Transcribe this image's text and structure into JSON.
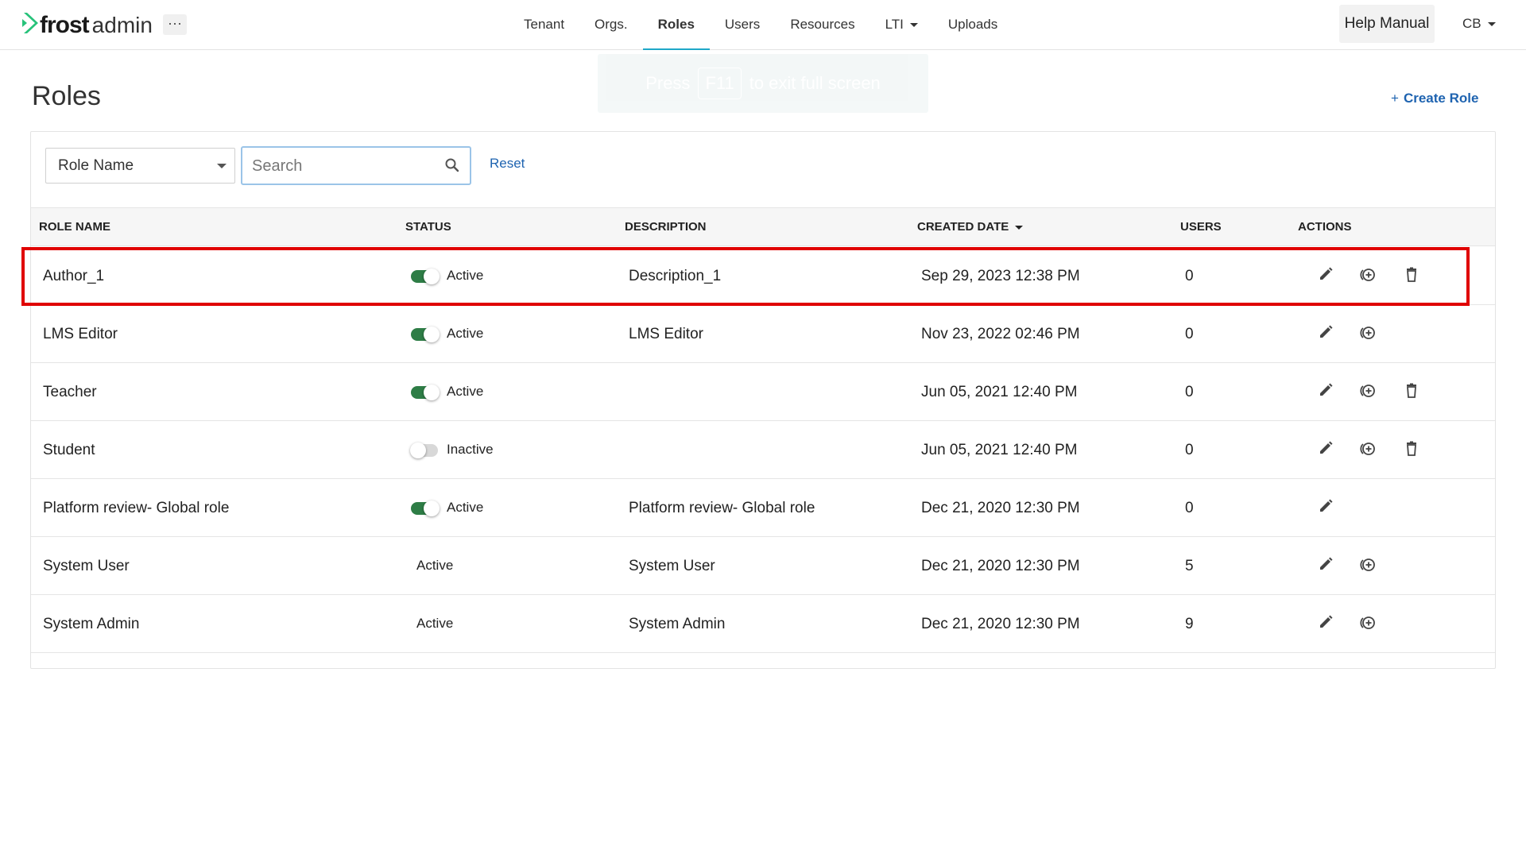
{
  "app": {
    "logo_frost": "frost",
    "logo_admin": "admin",
    "more_label": "···"
  },
  "nav": {
    "items": [
      {
        "label": "Tenant"
      },
      {
        "label": "Orgs."
      },
      {
        "label": "Roles"
      },
      {
        "label": "Users"
      },
      {
        "label": "Resources"
      },
      {
        "label": "LTI"
      },
      {
        "label": "Uploads"
      }
    ],
    "active": "Roles",
    "help_label": "Help Manual",
    "user_initials": "CB"
  },
  "fullscreen_toast": {
    "prefix": "Press",
    "key": "F11",
    "suffix": "to exit full screen"
  },
  "page": {
    "title": "Roles",
    "create_label": "Create Role",
    "create_plus": "+"
  },
  "filters": {
    "field_value": "Role Name",
    "search_placeholder": "Search",
    "search_value": "",
    "reset_label": "Reset"
  },
  "table": {
    "columns": {
      "role_name": "ROLE NAME",
      "status": "STATUS",
      "description": "DESCRIPTION",
      "created_date": "CREATED DATE",
      "users": "USERS",
      "actions": "ACTIONS"
    },
    "rows": [
      {
        "role": "Author_1",
        "status": "Active",
        "toggle": "on",
        "description": "Description_1",
        "created": "Sep 29, 2023 12:38 PM",
        "users": "0",
        "actions": [
          "edit",
          "copy",
          "delete"
        ]
      },
      {
        "role": "LMS Editor",
        "status": "Active",
        "toggle": "on",
        "description": "LMS Editor",
        "created": "Nov 23, 2022 02:46 PM",
        "users": "0",
        "actions": [
          "edit",
          "copy"
        ]
      },
      {
        "role": "Teacher",
        "status": "Active",
        "toggle": "on",
        "description": "",
        "created": "Jun 05, 2021 12:40 PM",
        "users": "0",
        "actions": [
          "edit",
          "copy",
          "delete"
        ]
      },
      {
        "role": "Student",
        "status": "Inactive",
        "toggle": "off",
        "description": "",
        "created": "Jun 05, 2021 12:40 PM",
        "users": "0",
        "actions": [
          "edit",
          "copy",
          "delete"
        ]
      },
      {
        "role": "Platform review- Global role",
        "status": "Active",
        "toggle": "on",
        "description": "Platform review- Global role",
        "created": "Dec 21, 2020 12:30 PM",
        "users": "0",
        "actions": [
          "edit"
        ]
      },
      {
        "role": "System User",
        "status": "Active",
        "toggle": "none",
        "description": "System User",
        "created": "Dec 21, 2020 12:30 PM",
        "users": "5",
        "actions": [
          "edit",
          "copy"
        ]
      },
      {
        "role": "System Admin",
        "status": "Active",
        "toggle": "none",
        "description": "System Admin",
        "created": "Dec 21, 2020 12:30 PM",
        "users": "9",
        "actions": [
          "edit",
          "copy"
        ]
      }
    ]
  },
  "colors": {
    "accent": "#1ea7c8",
    "link": "#1e63b0",
    "toggle_on": "#2e7d46",
    "highlight": "#e00000"
  },
  "icons": {
    "logo": "chevron-logo-icon",
    "search": "search-icon",
    "edit": "pencil-icon",
    "copy": "copy-role-icon",
    "delete": "trash-icon"
  }
}
